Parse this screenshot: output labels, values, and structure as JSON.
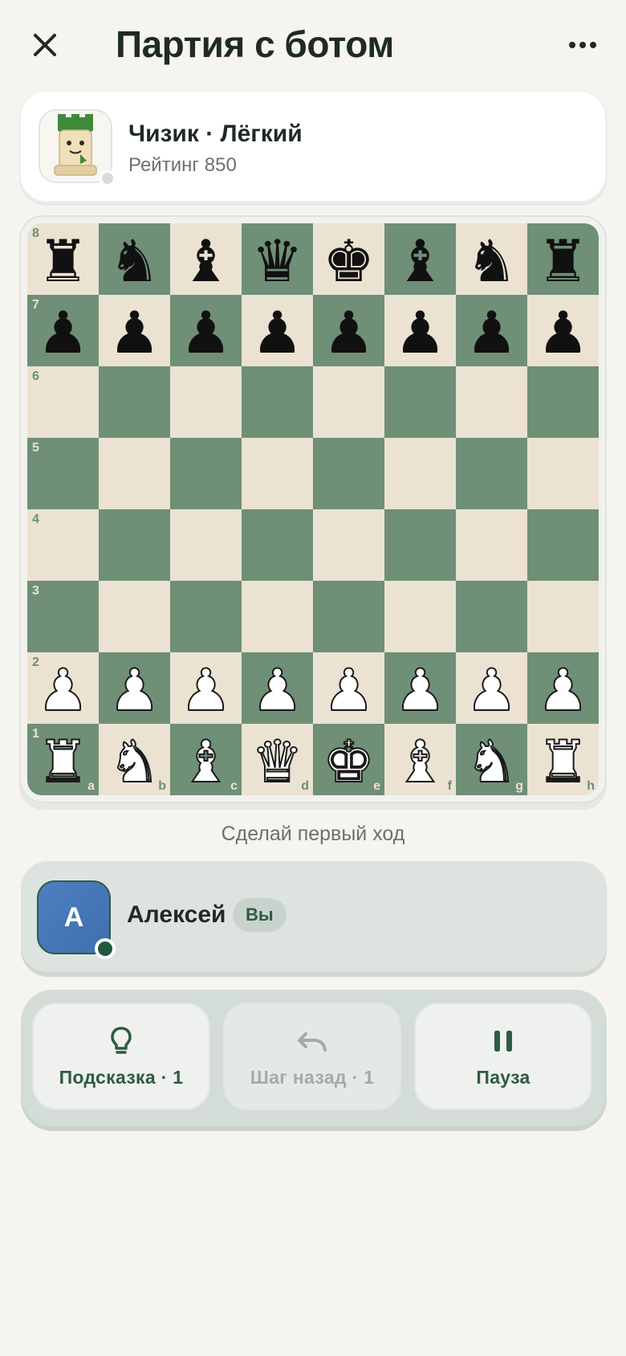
{
  "header": {
    "title": "Партия с ботом"
  },
  "opponent": {
    "name": "Чизик · Лёгкий",
    "rating": "Рейтинг 850"
  },
  "board": {
    "ranks": [
      {
        "label": "8",
        "squares": [
          {
            "piece": "♜",
            "side": "black"
          },
          {
            "piece": "♞",
            "side": "black"
          },
          {
            "piece": "♝",
            "side": "black"
          },
          {
            "piece": "♛",
            "side": "black"
          },
          {
            "piece": "♚",
            "side": "black"
          },
          {
            "piece": "♝",
            "side": "black"
          },
          {
            "piece": "♞",
            "side": "black"
          },
          {
            "piece": "♜",
            "side": "black"
          }
        ]
      },
      {
        "label": "7",
        "squares": [
          {
            "piece": "♟",
            "side": "black"
          },
          {
            "piece": "♟",
            "side": "black"
          },
          {
            "piece": "♟",
            "side": "black"
          },
          {
            "piece": "♟",
            "side": "black"
          },
          {
            "piece": "♟",
            "side": "black"
          },
          {
            "piece": "♟",
            "side": "black"
          },
          {
            "piece": "♟",
            "side": "black"
          },
          {
            "piece": "♟",
            "side": "black"
          }
        ]
      },
      {
        "label": "6",
        "squares": [
          {},
          {},
          {},
          {},
          {},
          {},
          {},
          {}
        ]
      },
      {
        "label": "5",
        "squares": [
          {},
          {},
          {},
          {},
          {},
          {},
          {},
          {}
        ]
      },
      {
        "label": "4",
        "squares": [
          {},
          {},
          {},
          {},
          {},
          {},
          {},
          {}
        ]
      },
      {
        "label": "3",
        "squares": [
          {},
          {},
          {},
          {},
          {},
          {},
          {},
          {}
        ]
      },
      {
        "label": "2",
        "squares": [
          {
            "piece": "♟",
            "side": "white"
          },
          {
            "piece": "♟",
            "side": "white"
          },
          {
            "piece": "♟",
            "side": "white"
          },
          {
            "piece": "♟",
            "side": "white"
          },
          {
            "piece": "♟",
            "side": "white"
          },
          {
            "piece": "♟",
            "side": "white"
          },
          {
            "piece": "♟",
            "side": "white"
          },
          {
            "piece": "♟",
            "side": "white"
          }
        ]
      },
      {
        "label": "1",
        "squares": [
          {
            "piece": "♜",
            "side": "white"
          },
          {
            "piece": "♞",
            "side": "white"
          },
          {
            "piece": "♝",
            "side": "white"
          },
          {
            "piece": "♛",
            "side": "white"
          },
          {
            "piece": "♚",
            "side": "white"
          },
          {
            "piece": "♝",
            "side": "white"
          },
          {
            "piece": "♞",
            "side": "white"
          },
          {
            "piece": "♜",
            "side": "white"
          }
        ]
      }
    ],
    "files": [
      "a",
      "b",
      "c",
      "d",
      "e",
      "f",
      "g",
      "h"
    ],
    "colors": {
      "light": "#ebe2d2",
      "dark": "#6f8f76"
    }
  },
  "status": "Сделай первый ход",
  "player": {
    "initial": "А",
    "name": "Алексей",
    "badge": "Вы"
  },
  "actions": {
    "hint_label": "Подсказка · 1",
    "undo_label": "Шаг назад · 1",
    "pause_label": "Пауза"
  },
  "icons": {
    "close": "close-icon",
    "more": "more-icon",
    "hint": "lightbulb-icon",
    "undo": "undo-icon",
    "pause": "pause-icon"
  }
}
